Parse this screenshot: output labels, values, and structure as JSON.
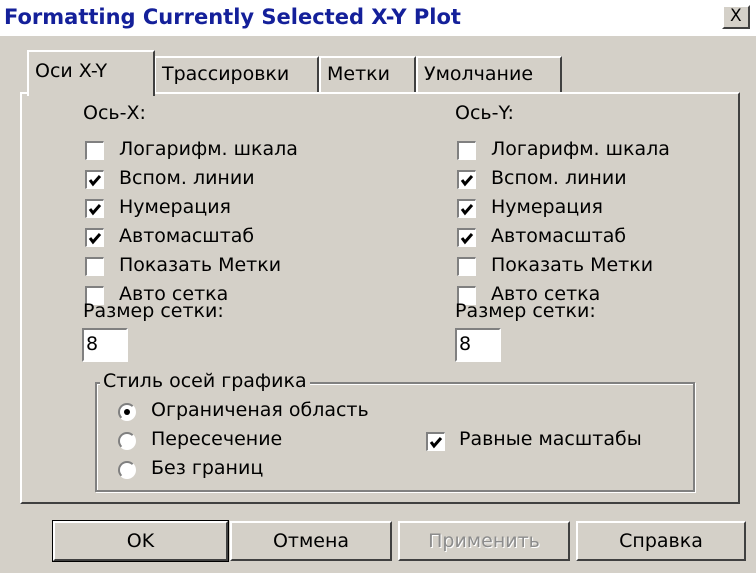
{
  "window": {
    "title": "Formatting Currently Selected X-Y Plot",
    "close_glyph": "X"
  },
  "tabs": [
    {
      "label": "Оси X-Y",
      "active": true
    },
    {
      "label": "Трассировки",
      "active": false
    },
    {
      "label": "Метки",
      "active": false
    },
    {
      "label": "Умолчание",
      "active": false
    }
  ],
  "x_axis": {
    "heading": "Ось-Х:",
    "options": [
      {
        "label": "Логарифм. шкала",
        "checked": false
      },
      {
        "label": "Вспом. линии",
        "checked": true
      },
      {
        "label": "Нумерация",
        "checked": true
      },
      {
        "label": "Автомасштаб",
        "checked": true
      },
      {
        "label": "Показать Метки",
        "checked": false
      },
      {
        "label": "Авто сетка",
        "checked": false
      }
    ],
    "grid_size_label": "Размер сетки:",
    "grid_size_value": "8"
  },
  "y_axis": {
    "heading": "Ось-Y:",
    "options": [
      {
        "label": "Логарифм. шкала",
        "checked": false
      },
      {
        "label": "Вспом. линии",
        "checked": true
      },
      {
        "label": "Нумерация",
        "checked": true
      },
      {
        "label": "Автомасштаб",
        "checked": true
      },
      {
        "label": "Показать Метки",
        "checked": false
      },
      {
        "label": "Авто сетка",
        "checked": false
      }
    ],
    "grid_size_label": "Размер сетки:",
    "grid_size_value": "8"
  },
  "axis_style": {
    "legend": "Стиль осей графика",
    "options": [
      {
        "label": "Ограниченая область",
        "selected": true
      },
      {
        "label": "Пересечение",
        "selected": false
      },
      {
        "label": "Без границ",
        "selected": false
      }
    ],
    "equal_scales": {
      "label": "Равные масштабы",
      "checked": true
    }
  },
  "buttons": {
    "ok": "OK",
    "cancel": "Отмена",
    "apply": "Применить",
    "help": "Справка"
  }
}
